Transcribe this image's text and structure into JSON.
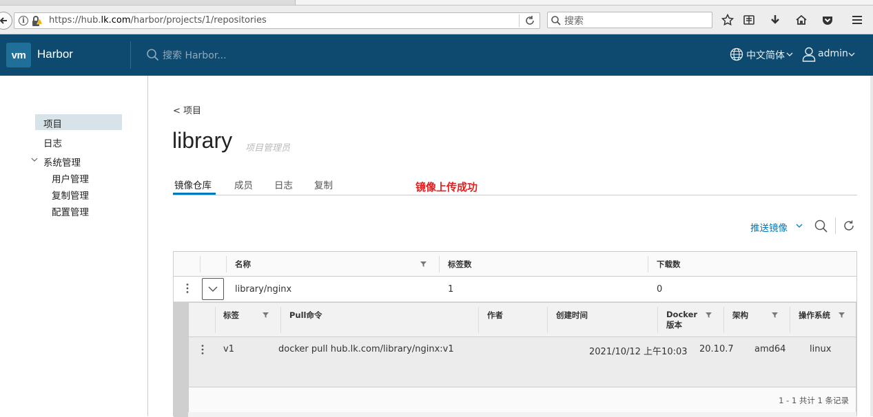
{
  "browser": {
    "url_prefix": "https://hub.",
    "url_host": "lk.com",
    "url_suffix": "/harbor/projects/1/repositories",
    "search_placeholder": "搜索"
  },
  "header": {
    "logo": "vm",
    "brand": "Harbor",
    "search_placeholder": "搜索 Harbor...",
    "language": "中文简体",
    "user": "admin"
  },
  "sidebar": {
    "items": [
      {
        "label": "项目"
      },
      {
        "label": "日志"
      },
      {
        "label": "系统管理"
      },
      {
        "label": "用户管理"
      },
      {
        "label": "复制管理"
      },
      {
        "label": "配置管理"
      }
    ]
  },
  "main": {
    "breadcrumb": "< 项目",
    "title": "library",
    "role": "项目管理员",
    "tabs": [
      {
        "label": "镜像仓库"
      },
      {
        "label": "成员"
      },
      {
        "label": "日志"
      },
      {
        "label": "复制"
      }
    ],
    "annotation": "镜像上传成功",
    "push_image": "推送镜像"
  },
  "grid": {
    "columns": [
      "名称",
      "标签数",
      "下载数"
    ],
    "rows": [
      {
        "name": "library/nginx",
        "tags": "1",
        "downloads": "0"
      }
    ]
  },
  "detail": {
    "columns": [
      "标签",
      "Pull命令",
      "作者",
      "创建时间",
      "Docker",
      "版本",
      "架构",
      "操作系统"
    ],
    "row": {
      "tag": "v1",
      "pull": "docker pull hub.lk.com/library/nginx:v1",
      "author": "",
      "created": "2021/10/12 上午10:03",
      "docker_version": "20.10.7",
      "arch": "amd64",
      "os": "linux"
    },
    "pagination": "1 - 1 共计 1 条记录"
  },
  "colors": {
    "header_bg": "#0e4a6f",
    "accent": "#0079b8",
    "annotation": "#e02020"
  }
}
